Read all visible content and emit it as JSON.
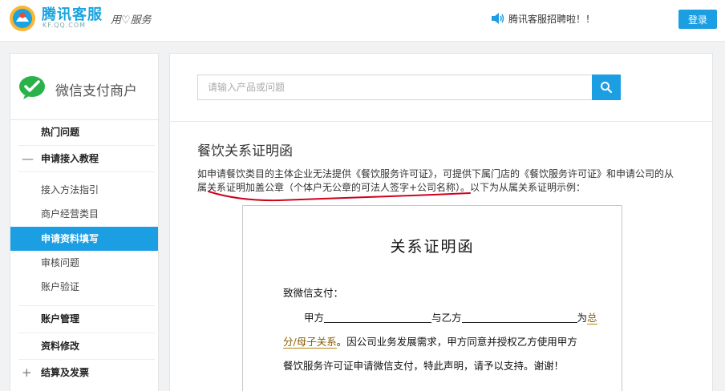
{
  "header": {
    "logo_text": "腾讯客服",
    "logo_sub": "KF.QQ.COM",
    "slogan": "用♡服务",
    "notice": "腾讯客服招聘啦！！",
    "login_label": "登录"
  },
  "sidebar": {
    "brand": "微信支付商户",
    "items": {
      "hot": "热门问题",
      "apply_tutorial": "申请接入教程",
      "apply_tutorial_icon": "—",
      "sub_access": "接入方法指引",
      "sub_category": "商户经营类目",
      "sub_fill": "申请资料填写",
      "sub_review": "审核问题",
      "sub_verify": "账户验证",
      "account": "账户管理",
      "profile_edit": "资料修改",
      "settlement": "结算及发票",
      "settlement_icon": "+"
    }
  },
  "search": {
    "placeholder": "请输入产品或问题"
  },
  "article": {
    "title": "餐饮关系证明函",
    "para_1": "如申请餐饮类目的主体企业无法提供《餐饮服务许可证》，可提供下属门店的《餐饮服务许可证》和申请公司的从",
    "para_2": "属关系证明加盖公章（个体户无公章的可法人签字+公司名称）。以下为从属关系证明示例："
  },
  "document": {
    "title": "关系证明函",
    "salutation": "致微信支付：",
    "party_a": "甲方",
    "and_party_b": "与乙方",
    "is": "为",
    "rel_end": "总",
    "rel_start": "分/母子关系",
    "line_3_rest": "。因公司业务发展需求，甲方同意并授权乙方使用甲方",
    "line_4": "餐饮服务许可证申请微信支付，特此声明，请予以支持。谢谢！"
  },
  "colors": {
    "accent": "#1c9ee3",
    "annotation": "#d0021b"
  }
}
